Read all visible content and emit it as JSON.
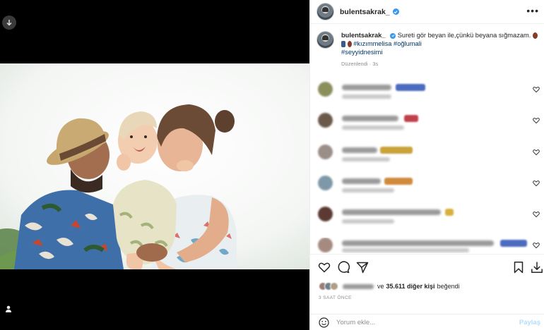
{
  "media": {
    "download_icon": "download-arrow-icon",
    "user_tag_icon": "person-icon"
  },
  "post": {
    "username": "bulentsakrak_",
    "verified_icon": "verified-badge-icon",
    "more_icon": "more-horizontal-icon",
    "more_label": "•••"
  },
  "caption": {
    "username": "bulentsakrak_",
    "text": "Sureti gör beyan ile,çünkü beyana sığmazam.",
    "hashtags": [
      "#kızımmelisa",
      "#oğlumali",
      "#seyyidnesimi"
    ],
    "edited": "Düzenlendi · 3s"
  },
  "comments": [
    {
      "avatar_color": "#8a8f5c",
      "emoji_color": "#4b6bbf",
      "heart_icon": "heart-outline-icon"
    },
    {
      "avatar_color": "#6b5a4a",
      "emoji_color": "#c0404a",
      "heart_icon": "heart-outline-icon"
    },
    {
      "avatar_color": "#9a8e88",
      "emoji_color": "#c9a23a",
      "heart_icon": "heart-outline-icon"
    },
    {
      "avatar_color": "#7f98a8",
      "emoji_color": "#d08a3c",
      "heart_icon": "heart-outline-icon"
    },
    {
      "avatar_color": "#5a3a32",
      "emoji_color": "#d8b03c",
      "heart_icon": "heart-outline-icon"
    },
    {
      "avatar_color": "#a58a80",
      "emoji_color": "#4b6bbf",
      "heart_icon": "heart-outline-icon"
    }
  ],
  "actions": {
    "like_icon": "heart-icon",
    "comment_icon": "comment-icon",
    "share_icon": "send-icon",
    "save_icon": "bookmark-icon",
    "download_icon": "download-icon"
  },
  "likes": {
    "text_prefix": "ve",
    "count_text": "35.611 diğer kişi",
    "suffix": "beğendi"
  },
  "time": "3 SAAT ÖNCE",
  "comment_box": {
    "placeholder": "Yorum ekle...",
    "share_label": "Paylaş",
    "emoji_icon": "smiley-icon"
  }
}
